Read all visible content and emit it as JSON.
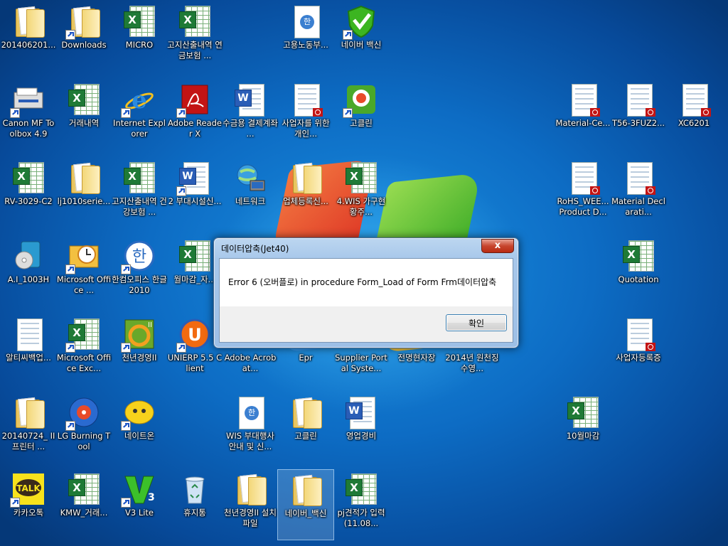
{
  "desktop": {
    "icons": [
      {
        "label": "201406201..."
      },
      {
        "label": "Downloads"
      },
      {
        "label": "MICRO"
      },
      {
        "label": "고지산출내역 연금보험 ..."
      },
      {
        "label": "고용노동부..."
      },
      {
        "label": "네이버 백신"
      },
      {
        "label": "Canon MF Toolbox 4.9"
      },
      {
        "label": "거래내역"
      },
      {
        "label": "Internet Explorer"
      },
      {
        "label": "Adobe Reader X"
      },
      {
        "label": "수금용 결제계좌 ..."
      },
      {
        "label": "사업자를 위한 개인..."
      },
      {
        "label": "고클린"
      },
      {
        "label": "Material-Ce..."
      },
      {
        "label": "T56-3FUZ2..."
      },
      {
        "label": "XC6201"
      },
      {
        "label": "RV-3029-C2"
      },
      {
        "label": "lj1010serie..."
      },
      {
        "label": "고지산출내역 건강보험 ..."
      },
      {
        "label": "2 부대시설신..."
      },
      {
        "label": "네트워크"
      },
      {
        "label": "업체등록신..."
      },
      {
        "label": "4.WIS 가구현황주..."
      },
      {
        "label": "RoHS_WEE... Product D..."
      },
      {
        "label": "Material Declarati..."
      },
      {
        "label": "A.I_1003H"
      },
      {
        "label": "Microsoft Office ..."
      },
      {
        "label": "한컴오피스 한글 2010"
      },
      {
        "label": "월마감_자..."
      },
      {
        "label": "Quotation"
      },
      {
        "label": "알티씨백업..."
      },
      {
        "label": "Microsoft Office Exc..."
      },
      {
        "label": "천년경영II"
      },
      {
        "label": "UNIERP 5.5 Client"
      },
      {
        "label": "Adobe Acrobat..."
      },
      {
        "label": "Epr"
      },
      {
        "label": "Supplier Portal Syste..."
      },
      {
        "label": "전명현자장"
      },
      {
        "label": "2014년 원천징수영..."
      },
      {
        "label": "사업자등록증"
      },
      {
        "label": "20140724_ II 프린터 ..."
      },
      {
        "label": "LG Burning Tool"
      },
      {
        "label": "네이트온"
      },
      {
        "label": "WIS 부대행사 안내 및 신..."
      },
      {
        "label": "고클린"
      },
      {
        "label": "영업경비"
      },
      {
        "label": "10월마감"
      },
      {
        "label": "카카오톡"
      },
      {
        "label": "KMW_거래..."
      },
      {
        "label": "V3 Lite"
      },
      {
        "label": "휴지통"
      },
      {
        "label": "천년경영II 설치파일"
      },
      {
        "label": "네이버_백신"
      },
      {
        "label": "pj견적가 입력(11.08..."
      }
    ]
  },
  "dialog": {
    "title": "데이터압축(Jet40)",
    "close_glyph": "x",
    "message": "Error 6 (오버플로) in procedure Form_Load of Form Frm데이터압축",
    "ok_label": "확인"
  },
  "colors": {
    "accent": "#0d6cc4",
    "dialog_frame": "#9dbfe6"
  }
}
